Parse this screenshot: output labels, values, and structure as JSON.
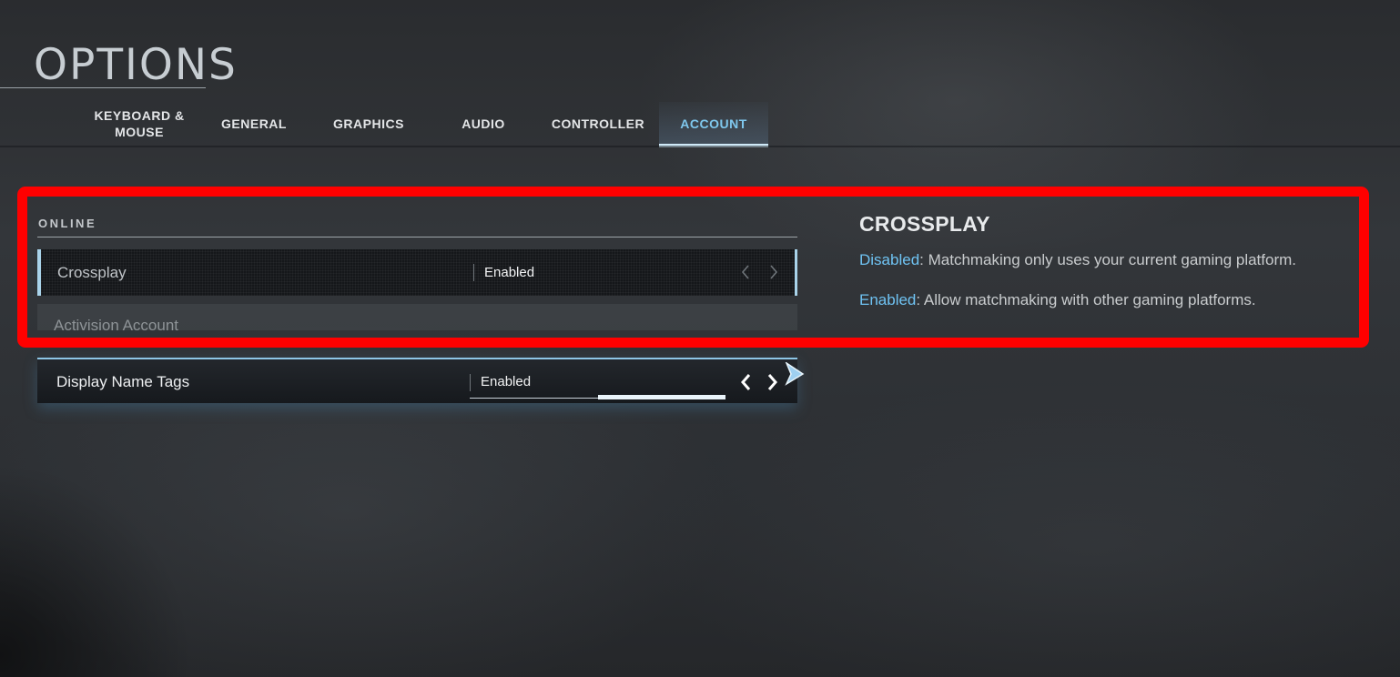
{
  "header": {
    "title": "OPTIONS"
  },
  "tabs": [
    {
      "label": "KEYBOARD & MOUSE",
      "active": false
    },
    {
      "label": "GENERAL",
      "active": false
    },
    {
      "label": "GRAPHICS",
      "active": false
    },
    {
      "label": "AUDIO",
      "active": false
    },
    {
      "label": "CONTROLLER",
      "active": false
    },
    {
      "label": "ACCOUNT",
      "active": true
    }
  ],
  "settings": {
    "section_title": "ONLINE",
    "rows": [
      {
        "label": "Crossplay",
        "value": "Enabled"
      },
      {
        "label": "Activision Account"
      },
      {
        "label": "Display Name Tags",
        "value": "Enabled"
      }
    ]
  },
  "description": {
    "title": "CROSSPLAY",
    "lines": [
      {
        "keyword": "Disabled",
        "text": ": Matchmaking only uses your current gaming platform."
      },
      {
        "keyword": "Enabled",
        "text": ": Allow matchmaking with other gaming platforms."
      }
    ]
  },
  "icons": {
    "prev": "chevron-left-icon",
    "next": "chevron-right-icon",
    "cursor": "mouse-cursor-icon"
  },
  "colors": {
    "accent": "#7fc8ee",
    "highlight_frame": "#ff0000",
    "keyword": "#6fc3f3"
  }
}
